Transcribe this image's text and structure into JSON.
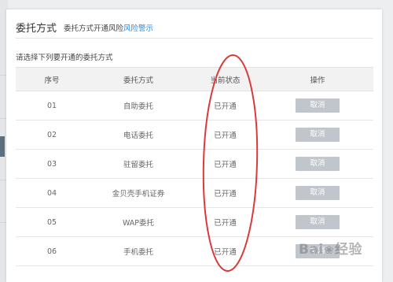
{
  "panel": {
    "title": "委托方式",
    "subtitle_prefix": "委托方式开通风险",
    "subtitle_link": "风险警示",
    "instruction": "请选择下列要开通的委托方式"
  },
  "table": {
    "headers": [
      "序号",
      "委托方式",
      "当前状态",
      "操作"
    ],
    "rows": [
      {
        "no": "01",
        "method": "自助委托",
        "status": "已开通",
        "action": "取消"
      },
      {
        "no": "02",
        "method": "电话委托",
        "status": "已开通",
        "action": "取消"
      },
      {
        "no": "03",
        "method": "驻留委托",
        "status": "已开通",
        "action": "取消"
      },
      {
        "no": "04",
        "method": "金贝壳手机证券",
        "status": "已开通",
        "action": "取消"
      },
      {
        "no": "05",
        "method": "WAP委托",
        "status": "已开通",
        "action": "取消"
      },
      {
        "no": "06",
        "method": "手机委托",
        "status": "已开通",
        "action": "取消"
      }
    ]
  },
  "annotation": {
    "color": "#d93a3a"
  },
  "watermark": {
    "text_left": "Bai",
    "text_right": "经验",
    "icon": "paw-icon"
  }
}
